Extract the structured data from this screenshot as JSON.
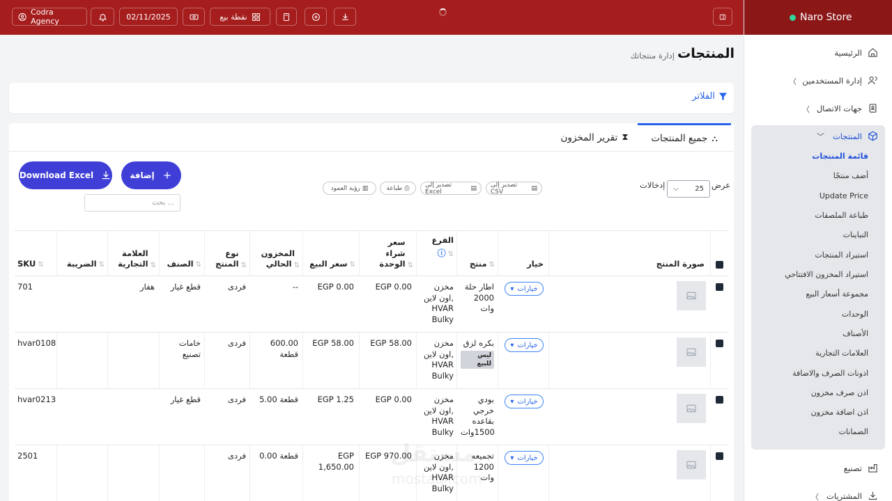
{
  "topbar": {
    "agency": "Codra Agency",
    "date": "02/11/2025",
    "pos_label": "نقطة بيع"
  },
  "sidebar": {
    "brand": "Naro Store",
    "home": "الرئيسية",
    "users": "إدارة المستخدمين",
    "contacts": "جهات الاتصال",
    "products": "المنتجات",
    "sub_items": [
      "قائمة المنتجات",
      "أضف منتجًا",
      "Update Price",
      "طباعة الملصقات",
      "التباينات",
      "استيراد المنتجات",
      "استيراد المخزون الافتتاحي",
      "مجموعة أسعار البيع",
      "الوحدات",
      "الأصناف",
      "العلامات التجارية",
      "اذونات الصرف والاضافة",
      "اذن صرف مخزون",
      "اذن اضافة مخزون",
      "الضمانات"
    ],
    "manufacturing": "تصنيع",
    "purchases": "المشتريات"
  },
  "page": {
    "title": "المنتجات",
    "subtitle": "إدارة منتجاتك",
    "filters": "الفلاتر"
  },
  "tabs": {
    "all_products": "جميع المنتجات",
    "stock_report": "تقرير المخزون"
  },
  "toolbar": {
    "download_excel": "Download Excel",
    "add": "إضافة",
    "search_placeholder": "بحث ...",
    "export_csv": "تصدير إلى CSV",
    "export_excel": "تصدير إلى Excel",
    "print": "طباعة",
    "column_visibility": "رؤية العمود",
    "show": "عرض",
    "entries_value": "25",
    "entries": "إدخالات"
  },
  "table": {
    "headers": {
      "image": "صورة المنتج",
      "option": "خيار",
      "product": "منتج",
      "branch": "الفرع",
      "unit_cost": "سعر شراء الوحدة",
      "sell_price": "سعر البيع",
      "stock": "المخزون الحالي",
      "type": "نوع المنتج",
      "category": "الصنف",
      "brand": "العلامة التجارية",
      "tax": "الضريبة",
      "sku": "SKU"
    },
    "options_label": "خيارات",
    "rows": [
      {
        "product": "اطار حلة 2000 وات",
        "badge": "",
        "branch": "مخزن اون لاين, HVAR Bulky",
        "unit_cost": "EGP 0.00",
        "sell_price": "EGP 0.00",
        "stock": "--",
        "type": "فردى",
        "category": "قطع غيار",
        "brand": "هفار",
        "tax": "",
        "sku": "701"
      },
      {
        "product": "بكره لزق",
        "badge": "ليس للبيع",
        "branch": "مخزن اون لاين, HVAR Bulky",
        "unit_cost": "EGP 58.00",
        "sell_price": "EGP 58.00",
        "stock": "600.00 قطعة",
        "type": "فردى",
        "category": "خامات تصنيع",
        "brand": "",
        "tax": "",
        "sku": "hvar0108"
      },
      {
        "product": "بودي خرجي بقاعده 1500وات",
        "badge": "",
        "branch": "مخزن اون لاين, HVAR Bulky",
        "unit_cost": "EGP 0.00",
        "sell_price": "EGP 1.25",
        "stock": "5.00 قطعة",
        "type": "فردى",
        "category": "قطع غيار",
        "brand": "",
        "tax": "",
        "sku": "hvar0213"
      },
      {
        "product": "تجميعه 1200 وات",
        "badge": "",
        "branch": "مخزن اون لاين, HVAR Bulky",
        "unit_cost": "EGP 970.00",
        "sell_price": "EGP 1,650.00",
        "stock": "0.00 قطعة",
        "type": "فردى",
        "category": "",
        "brand": "",
        "tax": "",
        "sku": "2501"
      }
    ]
  },
  "watermark": {
    "ar": "مستقل",
    "en": "mostaql.com"
  }
}
